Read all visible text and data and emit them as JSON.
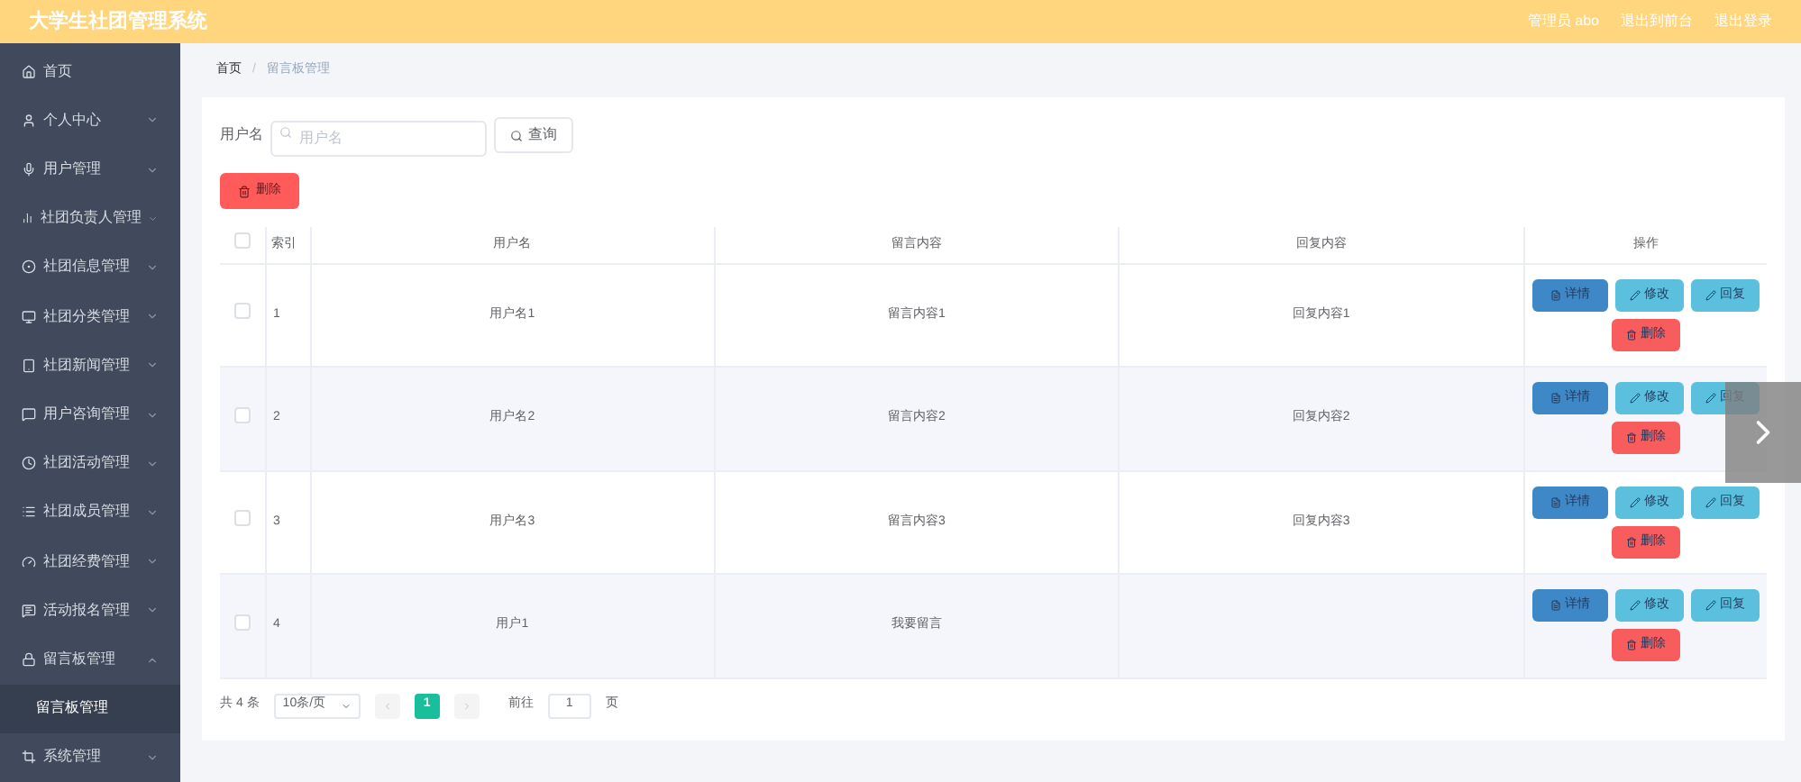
{
  "header": {
    "title": "大学生社团管理系统",
    "links": [
      "管理员 abo",
      "退出到前台",
      "退出登录"
    ]
  },
  "sidebar": {
    "items": [
      {
        "label": "首页"
      },
      {
        "label": "个人中心",
        "expanded": false
      },
      {
        "label": "用户管理",
        "expanded": false
      },
      {
        "label": "社团负责人管理",
        "expanded": false
      },
      {
        "label": "社团信息管理",
        "expanded": false
      },
      {
        "label": "社团分类管理",
        "expanded": false
      },
      {
        "label": "社团新闻管理",
        "expanded": false
      },
      {
        "label": "用户咨询管理",
        "expanded": false
      },
      {
        "label": "社团活动管理",
        "expanded": false
      },
      {
        "label": "社团成员管理",
        "expanded": false
      },
      {
        "label": "社团经费管理",
        "expanded": false
      },
      {
        "label": "活动报名管理",
        "expanded": false
      },
      {
        "label": "留言板管理",
        "expanded": true,
        "children": [
          {
            "label": "留言板管理",
            "selected": true
          }
        ]
      },
      {
        "label": "系统管理",
        "expanded": false
      }
    ]
  },
  "breadcrumb": {
    "items": [
      "首页",
      "留言板管理"
    ],
    "separator": "/"
  },
  "search": {
    "label": "用户名",
    "placeholder": "用户名",
    "button": "查询"
  },
  "delete_button": "删除",
  "table": {
    "columns": [
      "索引",
      "用户名",
      "留言内容",
      "回复内容",
      "操作"
    ],
    "select_all_checked": false,
    "rows": [
      {
        "checked": false,
        "cells": [
          "1",
          "用户名1",
          "留言内容1",
          "回复内容1"
        ],
        "actions": [
          {
            "label": "详情",
            "kind": "detail"
          },
          {
            "label": "修改",
            "kind": "edit"
          },
          {
            "label": "回复",
            "kind": "edit"
          },
          {
            "label": "删除",
            "kind": "delete"
          }
        ]
      },
      {
        "checked": false,
        "cells": [
          "2",
          "用户名2",
          "留言内容2",
          "回复内容2"
        ],
        "actions": [
          {
            "label": "详情",
            "kind": "detail"
          },
          {
            "label": "修改",
            "kind": "edit"
          },
          {
            "label": "回复",
            "kind": "edit"
          },
          {
            "label": "删除",
            "kind": "delete"
          }
        ]
      },
      {
        "checked": false,
        "cells": [
          "3",
          "用户名3",
          "留言内容3",
          "回复内容3"
        ],
        "actions": [
          {
            "label": "详情",
            "kind": "detail"
          },
          {
            "label": "修改",
            "kind": "edit"
          },
          {
            "label": "回复",
            "kind": "edit"
          },
          {
            "label": "删除",
            "kind": "delete"
          }
        ]
      },
      {
        "checked": false,
        "cells": [
          "4",
          "用户1",
          "我要留言",
          ""
        ],
        "actions": [
          {
            "label": "详情",
            "kind": "detail"
          },
          {
            "label": "修改",
            "kind": "edit"
          },
          {
            "label": "回复",
            "kind": "edit"
          },
          {
            "label": "删除",
            "kind": "delete"
          }
        ]
      }
    ]
  },
  "pagination": {
    "total": "共 4 条",
    "page_size": "10条/页",
    "pages": [
      {
        "label": "1",
        "selected": true
      }
    ],
    "goto_label": "前往",
    "goto_value": "1",
    "goto_suffix": "页"
  }
}
